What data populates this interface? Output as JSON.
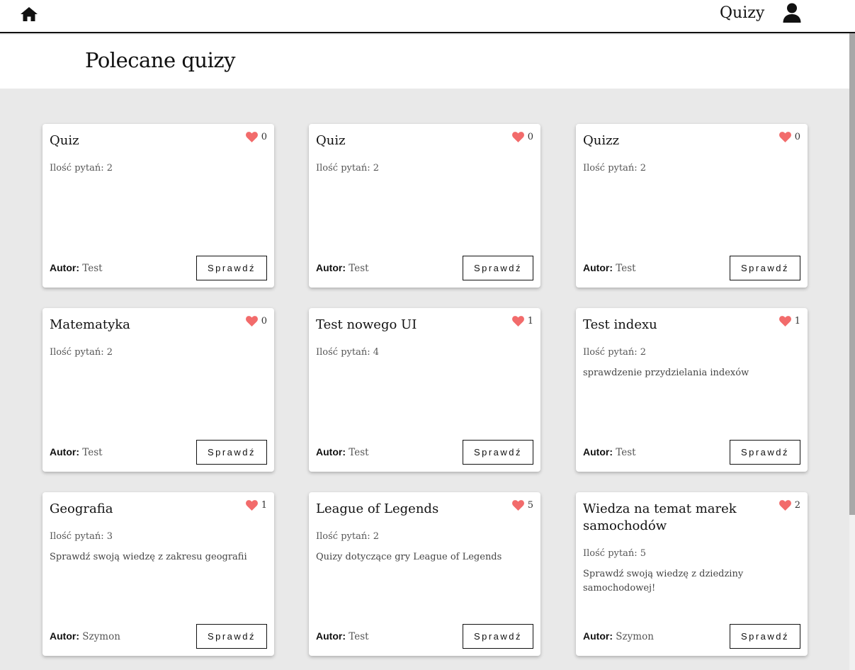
{
  "nav": {
    "title": "Quizy",
    "home_icon": "home-icon",
    "user_icon": "user-icon"
  },
  "page": {
    "title": "Polecane quizy"
  },
  "colors": {
    "heart": "#f26b6b",
    "background": "#e9e9e9",
    "card": "#ffffff"
  },
  "cards": [
    {
      "title": "Quiz",
      "likes": "0",
      "count": "Ilość pytań: 2",
      "description": "",
      "author_label": "Autor:",
      "author": "Test",
      "button": "Sprawdź"
    },
    {
      "title": "Quiz",
      "likes": "0",
      "count": "Ilość pytań: 2",
      "description": "",
      "author_label": "Autor:",
      "author": "Test",
      "button": "Sprawdź"
    },
    {
      "title": "Quizz",
      "likes": "0",
      "count": "Ilość pytań: 2",
      "description": "",
      "author_label": "Autor:",
      "author": "Test",
      "button": "Sprawdź"
    },
    {
      "title": "Matematyka",
      "likes": "0",
      "count": "Ilość pytań: 2",
      "description": "",
      "author_label": "Autor:",
      "author": "Test",
      "button": "Sprawdź"
    },
    {
      "title": "Test nowego UI",
      "likes": "1",
      "count": "Ilość pytań: 4",
      "description": "",
      "author_label": "Autor:",
      "author": "Test",
      "button": "Sprawdź"
    },
    {
      "title": "Test indexu",
      "likes": "1",
      "count": "Ilość pytań: 2",
      "description": "sprawdzenie przydzielania indexów",
      "author_label": "Autor:",
      "author": "Test",
      "button": "Sprawdź"
    },
    {
      "title": "Geografia",
      "likes": "1",
      "count": "Ilość pytań: 3",
      "description": "Sprawdź swoją wiedzę z zakresu geografii",
      "author_label": "Autor:",
      "author": "Szymon",
      "button": "Sprawdź"
    },
    {
      "title": "League of Legends",
      "likes": "5",
      "count": "Ilość pytań: 2",
      "description": "Quizy dotyczące gry League of Legends",
      "author_label": "Autor:",
      "author": "Test",
      "button": "Sprawdź"
    },
    {
      "title": "Wiedza na temat marek samochodów",
      "likes": "2",
      "count": "Ilość pytań: 5",
      "description": "Sprawdź swoją wiedzę z dziedziny samochodowej!",
      "author_label": "Autor:",
      "author": "Szymon",
      "button": "Sprawdź"
    }
  ]
}
